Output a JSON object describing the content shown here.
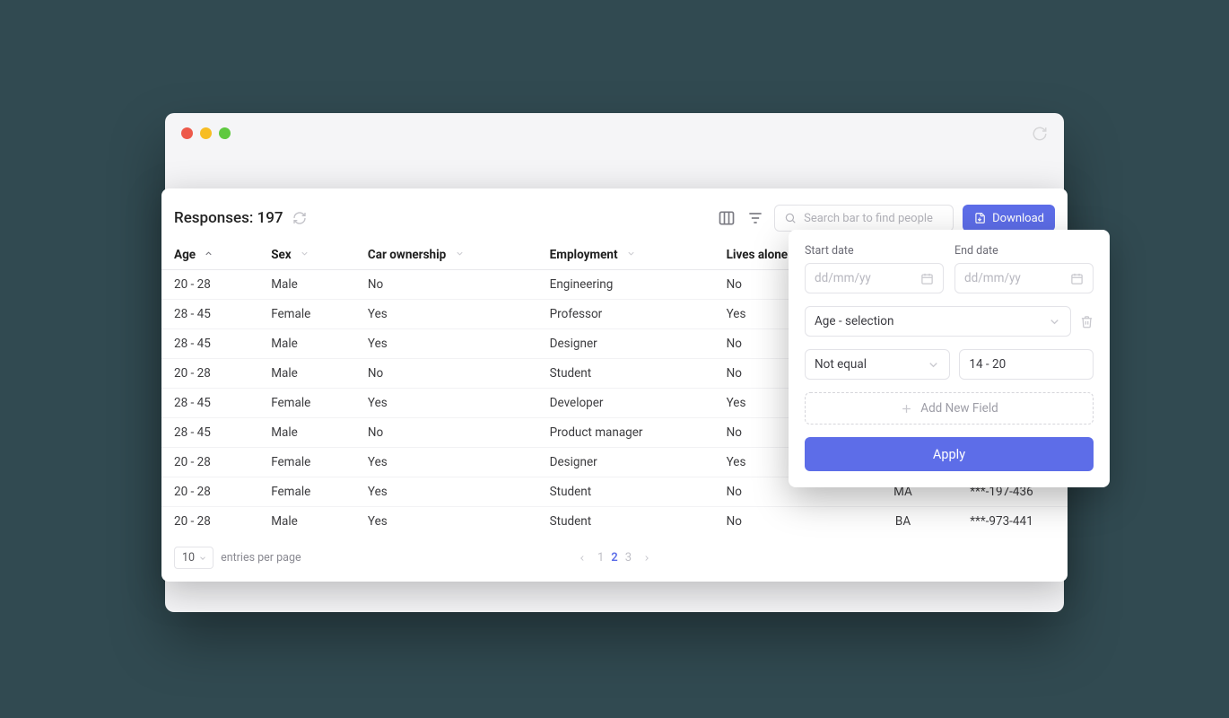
{
  "header": {
    "title_prefix": "Responses:",
    "count": "197",
    "search_placeholder": "Search bar to find people",
    "download_label": "Download"
  },
  "columns": [
    {
      "label": "Age",
      "sorted": true,
      "dir": "asc"
    },
    {
      "label": "Sex"
    },
    {
      "label": "Car ownership"
    },
    {
      "label": "Employment"
    },
    {
      "label": "Lives alone"
    },
    {
      "label": "Degree",
      "hidden_header": true
    },
    {
      "label": "Phone",
      "hidden_header": true
    }
  ],
  "rows": [
    {
      "age": "20 - 28",
      "sex": "Male",
      "car": "No",
      "emp": "Engineering",
      "alone": "No",
      "degree": "",
      "phone": ""
    },
    {
      "age": "28 - 45",
      "sex": "Female",
      "car": "Yes",
      "emp": "Professor",
      "alone": "Yes",
      "degree": "",
      "phone": ""
    },
    {
      "age": "28 - 45",
      "sex": "Male",
      "car": "Yes",
      "emp": "Designer",
      "alone": "No",
      "degree": "",
      "phone": ""
    },
    {
      "age": "20 - 28",
      "sex": "Male",
      "car": "No",
      "emp": "Student",
      "alone": "No",
      "degree": "",
      "phone": ""
    },
    {
      "age": "28 - 45",
      "sex": "Female",
      "car": "Yes",
      "emp": "Developer",
      "alone": "Yes",
      "degree": "",
      "phone": ""
    },
    {
      "age": "28 - 45",
      "sex": "Male",
      "car": "No",
      "emp": "Product manager",
      "alone": "No",
      "degree": "",
      "phone": ""
    },
    {
      "age": "20 - 28",
      "sex": "Female",
      "car": "Yes",
      "emp": "Designer",
      "alone": "Yes",
      "degree": "",
      "phone": ""
    },
    {
      "age": "20 - 28",
      "sex": "Female",
      "car": "Yes",
      "emp": "Student",
      "alone": "No",
      "degree": "MA",
      "phone": "***-197-436"
    },
    {
      "age": "20 - 28",
      "sex": "Male",
      "car": "Yes",
      "emp": "Student",
      "alone": "No",
      "degree": "BA",
      "phone": "***-973-441"
    }
  ],
  "footer": {
    "page_size": "10",
    "entries_label": "entries per page",
    "pages": [
      "1",
      "2",
      "3"
    ],
    "active_page": "2"
  },
  "filter": {
    "start_date_label": "Start date",
    "end_date_label": "End date",
    "date_placeholder": "dd/mm/yy",
    "field_select_value": "Age - selection",
    "operator_value": "Not equal",
    "value_value": "14 - 20",
    "add_field_label": "Add New Field",
    "apply_label": "Apply"
  }
}
